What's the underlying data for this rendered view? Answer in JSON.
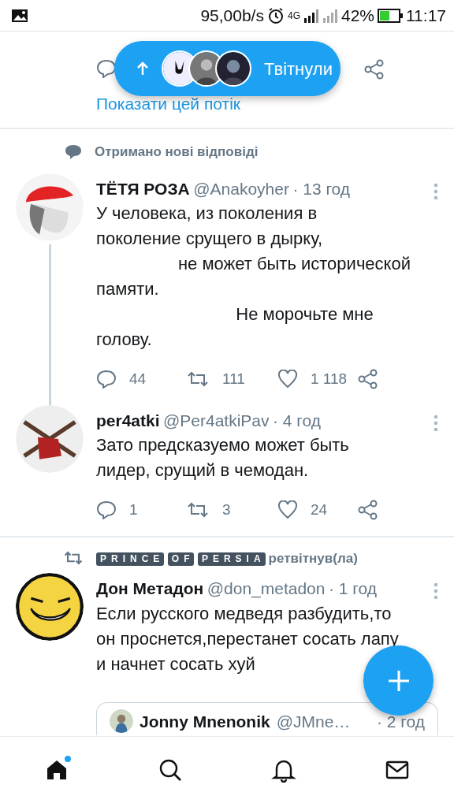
{
  "status_bar": {
    "speed": "95,00b/s",
    "network": "4G",
    "battery": "42%",
    "time": "11:17"
  },
  "new_tweets_pill": {
    "label": "Твітнули"
  },
  "prev_thread": {
    "link": "Показати цей потік"
  },
  "notice": "Отримано нові відповіді",
  "tweets": [
    {
      "name": "ТЁТЯ РОЗА",
      "handle": "@Anakoyher",
      "time": "· 13 год",
      "text": "У человека, из поколения в\nпоколение срущего в дырку,\n                 не может быть исторической\nпамяти.\n                             Не морочьте мне\nголову.",
      "replies": "44",
      "retweets": "111",
      "likes": "1 118",
      "thread_line": true
    },
    {
      "name": "per4atki",
      "handle": "@Per4atkiPav",
      "time": "· 4 год",
      "text": "Зато предсказуемо может быть\nлидер, срущий в чемодан.",
      "replies": "1",
      "retweets": "3",
      "likes": "24",
      "thread_line": false
    }
  ],
  "retweet": {
    "by": "PRINCE OF PERSIA",
    "suffix": "ретвітнув(ла)",
    "name": "Дон Метадон",
    "handle": "@don_metadon",
    "time": "· 1 год",
    "text": "Если русского медведя разбудить,то\nон проснется,перестанет сосать лапу\nи начнет сосать хуй",
    "quote": {
      "name": "Jonny Mnenonik",
      "handle": "@JMne…",
      "time": "· 2 год"
    }
  },
  "bottom_nav": [
    {
      "kind": "home",
      "selected": true,
      "badge": true
    },
    {
      "kind": "search",
      "selected": false,
      "badge": false
    },
    {
      "kind": "bell",
      "selected": false,
      "badge": false
    },
    {
      "kind": "mail",
      "selected": false,
      "badge": false
    }
  ]
}
